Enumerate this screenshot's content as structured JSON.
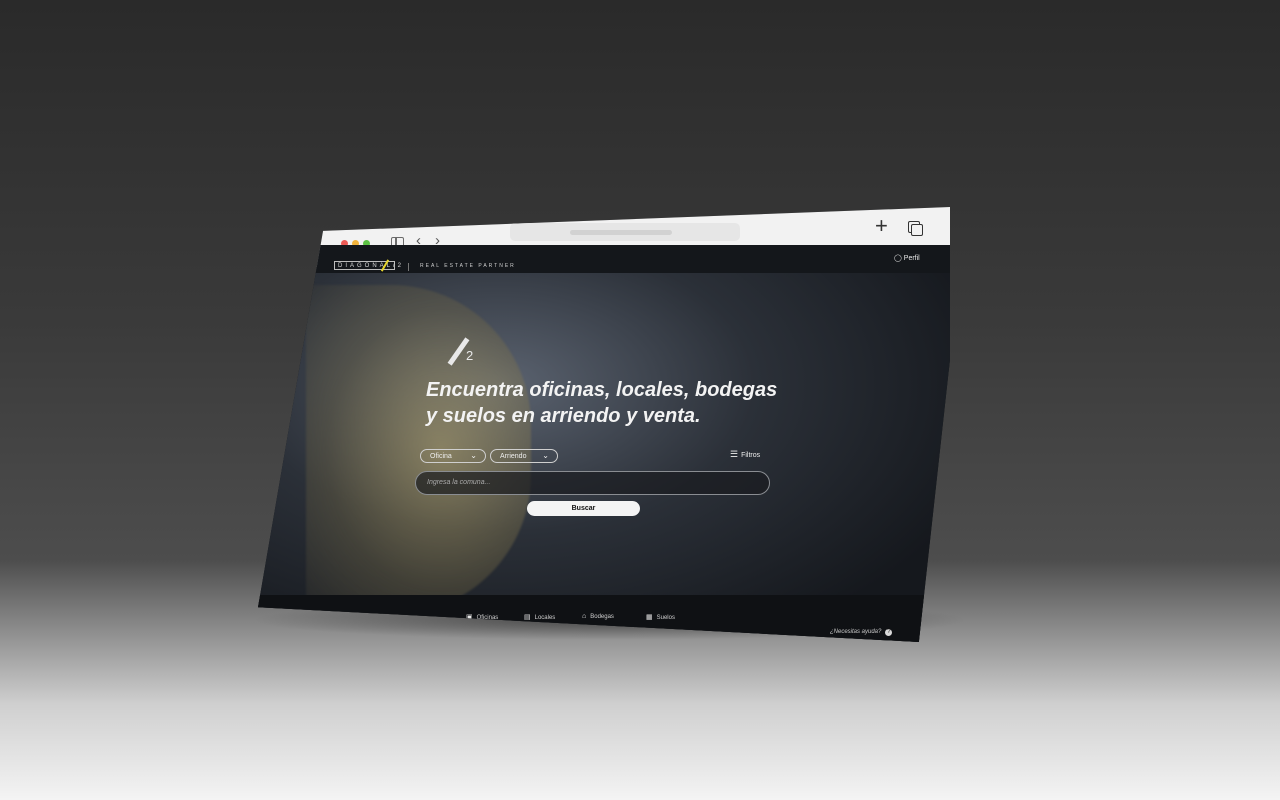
{
  "browser": {
    "new_tab_icon": "plus-icon",
    "tabs_icon": "tabs-overview-icon"
  },
  "site": {
    "logo_text": "DIAGONAL/2",
    "tagline": "REAL ESTATE PARTNER",
    "profile_label": "Perfil",
    "hero_mark_number": "2",
    "headline_line1": "Encuentra oficinas, locales, bodegas",
    "headline_line2": "y suelos en arriendo y venta.",
    "property_type_selected": "Oficina",
    "operation_selected": "Arriendo",
    "filters_label": "Filtros",
    "search_placeholder": "Ingresa la comuna...",
    "search_button": "Buscar",
    "bottom_nav": [
      "Oficinas",
      "Locales",
      "Bodegas",
      "Suelos"
    ],
    "help_text": "¿Necesitas ayuda?",
    "accent_color": "#e6d52b"
  }
}
